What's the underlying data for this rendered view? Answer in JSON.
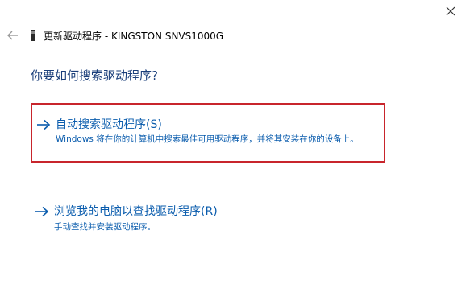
{
  "window": {
    "title": "更新驱动程序 - KINGSTON SNVS1000G"
  },
  "icons": {
    "back": "back-arrow-icon",
    "device": "device-icon",
    "close": "close-icon",
    "option_arrow": "right-arrow-icon"
  },
  "main": {
    "heading": "你要如何搜索驱动程序?",
    "options": [
      {
        "title": "自动搜索驱动程序(S)",
        "description": "Windows 将在你的计算机中搜索最佳可用驱动程序，并将其安装在你的设备上。"
      },
      {
        "title": "浏览我的电脑以查找驱动程序(R)",
        "description": "手动查找并安装驱动程序。"
      }
    ]
  },
  "colors": {
    "link": "#0a5cad",
    "heading": "#1a3e7a",
    "highlight_border": "#c8252c"
  }
}
